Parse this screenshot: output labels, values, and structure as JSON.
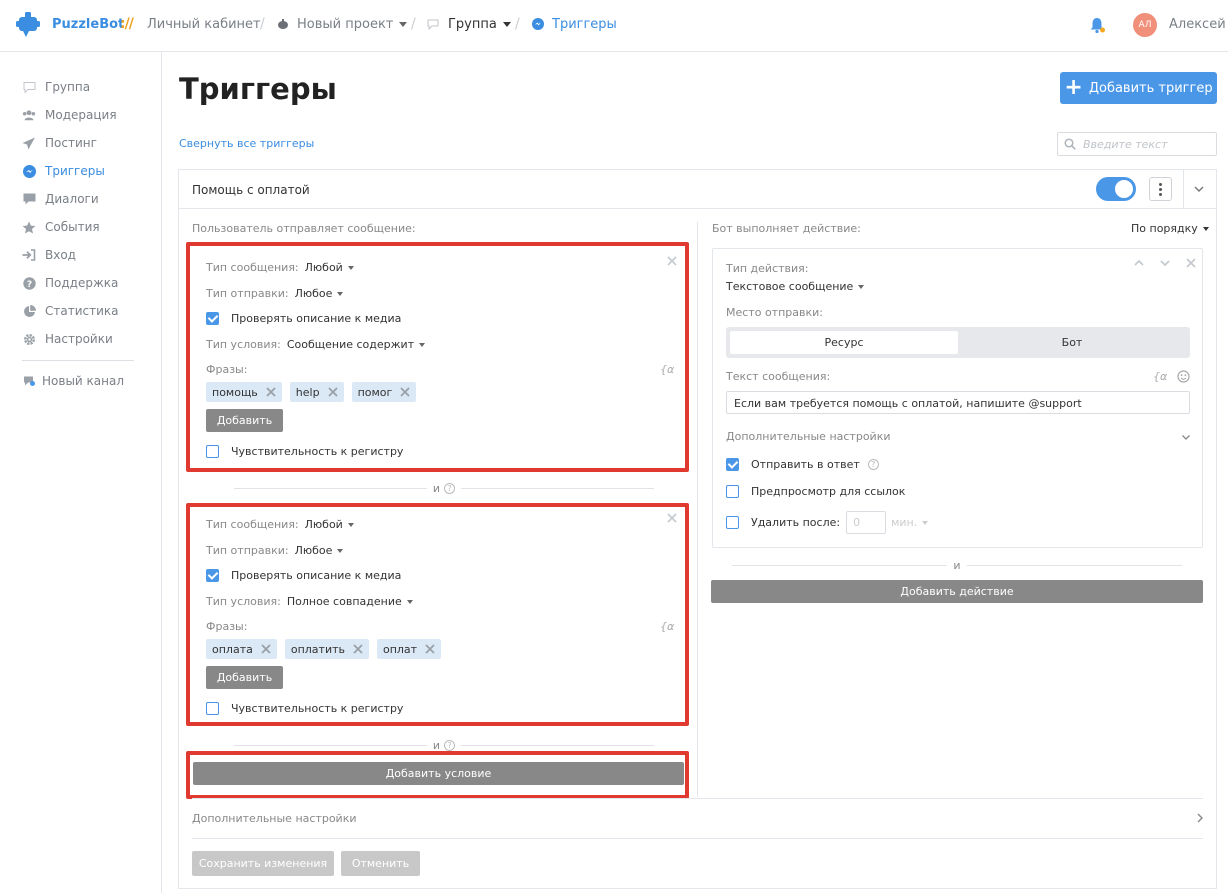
{
  "header": {
    "brand": "PuzzleBot",
    "brand_sep": "://",
    "crumbs": {
      "cabinet": "Личный кабинет",
      "project": "Новый проект",
      "group": "Группа",
      "triggers": "Триггеры"
    },
    "avatar_initials": "АЛ",
    "user_name": "Алексей"
  },
  "sidebar": {
    "items": [
      {
        "label": "Группа",
        "icon": "chat-bubble-icon"
      },
      {
        "label": "Модерация",
        "icon": "users-icon"
      },
      {
        "label": "Постинг",
        "icon": "paper-plane-icon"
      },
      {
        "label": "Триггеры",
        "icon": "trigger-icon"
      },
      {
        "label": "Диалоги",
        "icon": "dialog-icon"
      },
      {
        "label": "События",
        "icon": "star-icon"
      },
      {
        "label": "Вход",
        "icon": "sign-in-icon"
      },
      {
        "label": "Поддержка",
        "icon": "question-icon"
      },
      {
        "label": "Статистика",
        "icon": "pie-chart-icon"
      },
      {
        "label": "Настройки",
        "icon": "gear-icon"
      }
    ],
    "new_channel": "Новый канал"
  },
  "main": {
    "title": "Триггеры",
    "add_trigger": "Добавить триггер",
    "collapse_all": "Свернуть все триггеры",
    "search_placeholder": "Введите текст"
  },
  "trigger": {
    "name": "Помощь с оплатой",
    "enabled": true,
    "user_sends_label": "Пользователь отправляет сообщение:",
    "bot_does_label": "Бот выполняет действие:",
    "order": "По порядку",
    "conditions": [
      {
        "msg_type_label": "Тип сообщения:",
        "msg_type": "Любой",
        "send_type_label": "Тип отправки:",
        "send_type": "Любое",
        "check_media": "Проверять описание к медиа",
        "cond_type_label": "Тип условия:",
        "cond_type": "Сообщение содержит",
        "phrases_label": "Фразы:",
        "phrases": [
          "помощь",
          "help",
          "помог"
        ],
        "add_label": "Добавить",
        "case_sensitive": "Чувствительность к регистру",
        "var_symbol": "{α"
      },
      {
        "msg_type_label": "Тип сообщения:",
        "msg_type": "Любой",
        "send_type_label": "Тип отправки:",
        "send_type": "Любое",
        "check_media": "Проверять описание к медиа",
        "cond_type_label": "Тип условия:",
        "cond_type": "Полное совпадение",
        "phrases_label": "Фразы:",
        "phrases": [
          "оплата",
          "оплатить",
          "оплат"
        ],
        "add_label": "Добавить",
        "case_sensitive": "Чувствительность к регистру",
        "var_symbol": "{α"
      }
    ],
    "and_label": "и",
    "help_symbol": "?",
    "add_condition": "Добавить условие",
    "action": {
      "type_label": "Тип действия:",
      "type": "Текстовое сообщение",
      "place_label": "Место отправки:",
      "place_options": [
        "Ресурс",
        "Бот"
      ],
      "text_label": "Текст сообщения:",
      "text_value": "Если вам требуется помощь с оплатой, напишите @support",
      "extra_label": "Дополнительные настройки",
      "reply_label": "Отправить в ответ",
      "preview_label": "Предпросмотр для ссылок",
      "delete_label": "Удалить после:",
      "delete_value": "0",
      "delete_unit": "мин."
    },
    "add_action": "Добавить действие",
    "extra_settings": "Дополнительные настройки",
    "save": "Сохранить изменения",
    "cancel": "Отменить"
  },
  "colors": {
    "accent": "#4a97e8",
    "highlight": "#e03a30",
    "tag": "#dbe8f6"
  }
}
